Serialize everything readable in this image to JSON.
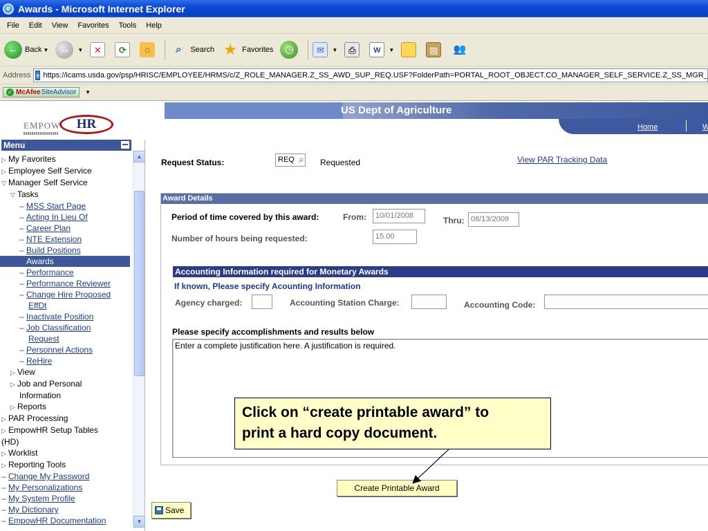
{
  "window": {
    "title": "Awards - Microsoft Internet Explorer",
    "icon": "ie-logo-icon"
  },
  "menubar": {
    "items": [
      "File",
      "Edit",
      "View",
      "Favorites",
      "Tools",
      "Help"
    ]
  },
  "toolbar": {
    "back_label": "Back",
    "search_label": "Search",
    "favorites_label": "Favorites"
  },
  "address": {
    "label": "Address",
    "url": "https://icams.usda.gov/psp/HRISC/EMPLOYEE/HRMS/c/Z_ROLE_MANAGER.Z_SS_AWD_SUP_REQ.USF?FolderPath=PORTAL_ROOT_OBJECT.CO_MANAGER_SELF_SERVICE.Z_SS_MGR_"
  },
  "mcafee": {
    "brand": "McAfee",
    "product": "SiteAdvisor"
  },
  "header": {
    "logo_text": "EmpowHR",
    "logo_empow": "EMPOW",
    "logo_hr": "HR",
    "org_title": "US Dept of Agriculture",
    "nav": {
      "home": "Home",
      "worklist_partial": "W"
    }
  },
  "sidebar": {
    "title": "Menu",
    "items": [
      {
        "label": "My Favorites",
        "type": "folder-closed",
        "indent": 0
      },
      {
        "label": "Employee Self Service",
        "type": "folder-closed",
        "indent": 0
      },
      {
        "label": "Manager Self Service",
        "type": "folder-open",
        "indent": 0
      },
      {
        "label": "Tasks",
        "type": "folder-open",
        "indent": 1
      },
      {
        "label": "MSS Start Page",
        "type": "link",
        "indent": 2
      },
      {
        "label": "Acting In Lieu Of",
        "type": "link",
        "indent": 2
      },
      {
        "label": "Career Plan",
        "type": "link",
        "indent": 2
      },
      {
        "label": "NTE Extension",
        "type": "link",
        "indent": 2
      },
      {
        "label": "Build Positions",
        "type": "link",
        "indent": 2
      },
      {
        "label": "Awards",
        "type": "selected",
        "indent": 2
      },
      {
        "label": "Performance",
        "type": "link",
        "indent": 2
      },
      {
        "label": "Performance Reviewer",
        "type": "link",
        "indent": 2
      },
      {
        "label": "Change Hire Proposed",
        "type": "link",
        "indent": 2
      },
      {
        "label": "EffDt",
        "type": "link-cont",
        "indent": 3
      },
      {
        "label": "Inactivate Position",
        "type": "link",
        "indent": 2
      },
      {
        "label": "Job Classification",
        "type": "link",
        "indent": 2
      },
      {
        "label": "Request",
        "type": "link-cont",
        "indent": 3
      },
      {
        "label": "Personnel Actions",
        "type": "link",
        "indent": 2
      },
      {
        "label": "ReHire",
        "type": "link",
        "indent": 2
      },
      {
        "label": "View",
        "type": "folder-closed",
        "indent": 1
      },
      {
        "label": "Job and Personal",
        "type": "folder-closed",
        "indent": 1
      },
      {
        "label": "Information",
        "type": "text-cont",
        "indent": 2
      },
      {
        "label": "Reports",
        "type": "folder-closed",
        "indent": 1
      },
      {
        "label": "PAR Processing",
        "type": "folder-closed",
        "indent": 0
      },
      {
        "label": "EmpowHR Setup Tables",
        "type": "folder-closed",
        "indent": 0
      },
      {
        "label": "(HD)",
        "type": "text-cont",
        "indent": 0
      },
      {
        "label": "Worklist",
        "type": "folder-closed",
        "indent": 0
      },
      {
        "label": "Reporting Tools",
        "type": "folder-closed",
        "indent": 0
      },
      {
        "label": "Change My Password",
        "type": "link",
        "indent": 0
      },
      {
        "label": "My Personalizations",
        "type": "link",
        "indent": 0
      },
      {
        "label": "My System Profile",
        "type": "link",
        "indent": 0
      },
      {
        "label": "My Dictionary",
        "type": "link",
        "indent": 0
      },
      {
        "label": "EmpowHR Documentation",
        "type": "link",
        "indent": 0
      }
    ]
  },
  "main": {
    "request_status_label": "Request Status:",
    "request_status_code": "REQ",
    "request_status_text": "Requested",
    "par_tracking_link": "View PAR Tracking Data",
    "award_details": {
      "header": "Award Details",
      "period_label": "Period of time covered by this award:",
      "from_label": "From:",
      "from_value": "10/01/2008",
      "thru_label": "Thru:",
      "thru_value": "08/13/2009",
      "hours_label": "Number of hours being requested:",
      "hours_value": "15.00"
    },
    "accounting": {
      "header": "Accounting Information required for Monetary Awards",
      "subheader": "If known, Please specify Acounting Information",
      "agency_label": "Agency charged:",
      "agency_value": "",
      "station_label": "Accounting Station Charge:",
      "station_value": "",
      "code_label": "Accounting Code:",
      "code_value": ""
    },
    "accomplishments_label": "Please specify accomplishments and results below",
    "accomplishments_text": "Enter a complete justification here. A justification is required.",
    "create_printable_award": "Create Printable Award",
    "save_label": "Save"
  },
  "callout": {
    "line1": "Click on “create printable award” to",
    "line2": "print a hard copy document."
  }
}
